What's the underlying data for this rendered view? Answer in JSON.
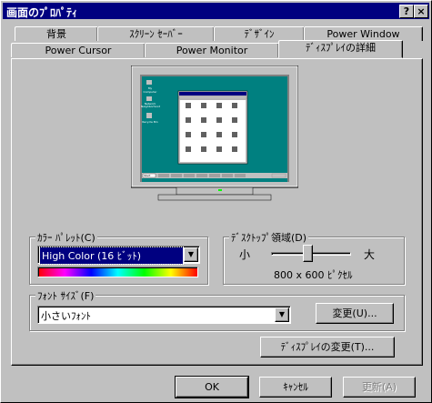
{
  "window": {
    "title": "画面のﾌﾟﾛﾊﾟﾃｨ",
    "help_label": "?",
    "close_label": "×"
  },
  "tabs_back": [
    "背景",
    "ｽｸﾘｰﾝ ｾｰﾊﾞｰ",
    "ﾃﾞｻﾞｲﾝ",
    "Power Window"
  ],
  "tabs_front": [
    "Power Cursor",
    "Power Monitor",
    "ﾃﾞｨｽﾌﾟﾚｲの詳細"
  ],
  "preview": {
    "desktop_icons": [
      "My Computer",
      "Network Neighborhood",
      "Recycle Bin"
    ],
    "taskbar_start": "Start"
  },
  "color_palette": {
    "label": "ｶﾗｰ ﾊﾟﾚｯﾄ(C)",
    "value": "High Color (16 ﾋﾞｯﾄ)",
    "spectrum": [
      "#ff0000",
      "#ff00ff",
      "#0000ff",
      "#00ffff",
      "#00ff00",
      "#ffff00",
      "#ff0000"
    ]
  },
  "desktop_area": {
    "label": "ﾃﾞｽｸﾄｯﾌﾟ領域(D)",
    "min_label": "小",
    "max_label": "大",
    "slider_position": 0.45,
    "resolution": "800 x 600 ﾋﾟｸｾﾙ"
  },
  "font_size": {
    "label": "ﾌｫﾝﾄ ｻｲｽﾞ(F)",
    "value": "小さいﾌｫﾝﾄ",
    "change_button": "変更(U)..."
  },
  "change_display_button": "ﾃﾞｨｽﾌﾟﾚｲの変更(T)...",
  "buttons": {
    "ok": "OK",
    "cancel": "ｷｬﾝｾﾙ",
    "apply": "更新(A)"
  },
  "colors": {
    "titlebar": "#000080",
    "face": "#c0c0c0",
    "desktop": "#008080",
    "selection": "#000080"
  }
}
